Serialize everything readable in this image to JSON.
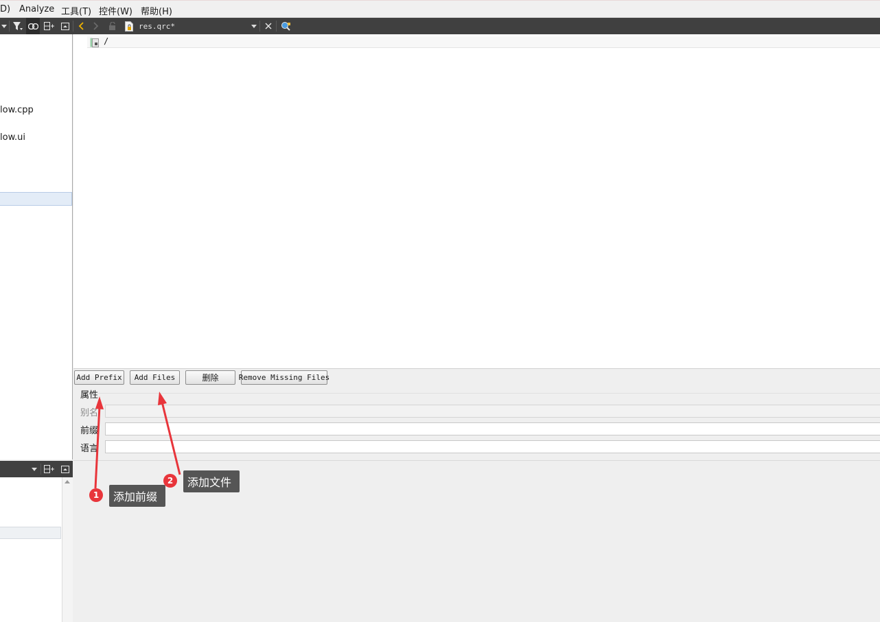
{
  "menubar": {
    "items": [
      "D)",
      "Analyze",
      "工具(T)",
      "控件(W)",
      "帮助(H)"
    ]
  },
  "toolbar": {
    "open_file": "res.qrc*",
    "icons": [
      "dropdown-arrow-icon",
      "filter-icon",
      "link-icon",
      "split-add-icon",
      "collapse-icon",
      "back-icon",
      "forward-icon",
      "lock-icon",
      "file-icon",
      "dropdown-arrow-icon",
      "close-icon",
      "locator-icon"
    ]
  },
  "project_tree": {
    "items": [
      "low.cpp",
      "low.ui"
    ]
  },
  "resource_tree": {
    "root_label": "/"
  },
  "buttons": {
    "add_prefix": "Add Prefix",
    "add_files": "Add Files",
    "delete": "删除",
    "remove_missing": "Remove Missing Files"
  },
  "properties": {
    "heading": "属性",
    "alias_label": "别名",
    "prefix_label": "前缀",
    "language_label": "语言"
  },
  "annotations": [
    {
      "number": "1",
      "text": "添加前缀"
    },
    {
      "number": "2",
      "text": "添加文件"
    }
  ],
  "colors": {
    "dark_toolbar": "#404040",
    "annotation_red": "#e8353b",
    "callout_bg": "#555555"
  }
}
